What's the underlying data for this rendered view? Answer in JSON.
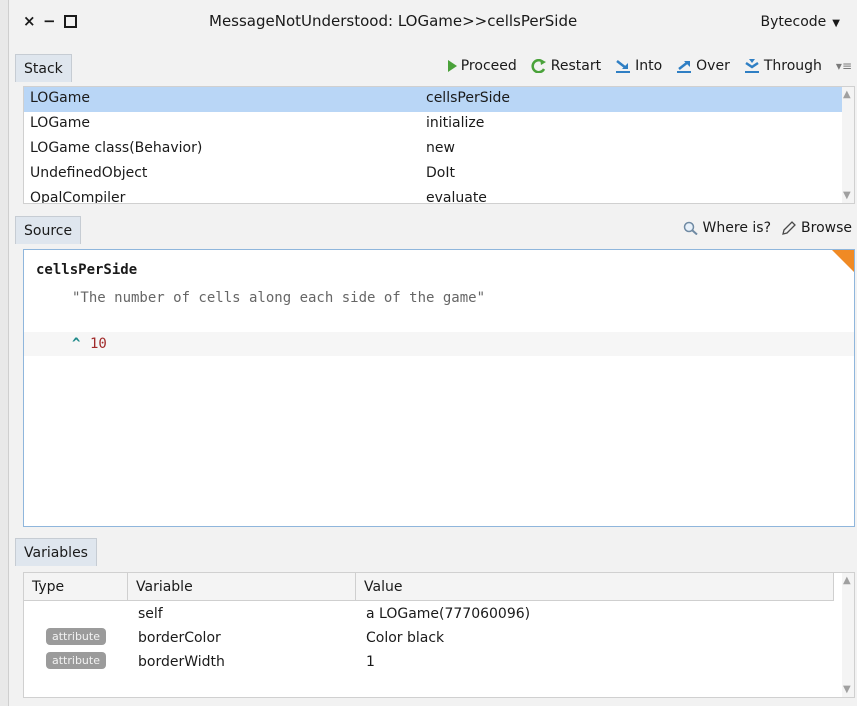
{
  "window": {
    "title": "MessageNotUnderstood: LOGame>>cellsPerSide",
    "close_label": "×",
    "minimize_label": "−",
    "mode_selector": "Bytecode"
  },
  "stack": {
    "tab_label": "Stack",
    "toolbar": {
      "proceed": "Proceed",
      "restart": "Restart",
      "into": "Into",
      "over": "Over",
      "through": "Through"
    },
    "rows": [
      {
        "receiver": "LOGame",
        "selector": "cellsPerSide"
      },
      {
        "receiver": "LOGame",
        "selector": "initialize"
      },
      {
        "receiver": "LOGame class(Behavior)",
        "selector": "new"
      },
      {
        "receiver": "UndefinedObject",
        "selector": "DoIt"
      },
      {
        "receiver": "OpalCompiler",
        "selector": "evaluate"
      }
    ]
  },
  "source": {
    "tab_label": "Source",
    "where_is": "Where is?",
    "browse": "Browse",
    "selector": "cellsPerSide",
    "comment": "\"The number of cells along each side of the game\"",
    "return_caret": "^",
    "return_value": "10"
  },
  "variables": {
    "tab_label": "Variables",
    "columns": {
      "type": "Type",
      "variable": "Variable",
      "value": "Value"
    },
    "rows": [
      {
        "type": "",
        "variable": "self",
        "value": "a LOGame(777060096)"
      },
      {
        "type": "attribute",
        "variable": "borderColor",
        "value": "Color black"
      },
      {
        "type": "attribute",
        "variable": "borderWidth",
        "value": "1"
      }
    ]
  },
  "colors": {
    "selection": "#b9d6f6",
    "accent_orange": "#f08a24",
    "proceed_green": "#4aa23a",
    "icon_blue": "#2f7fc4"
  }
}
